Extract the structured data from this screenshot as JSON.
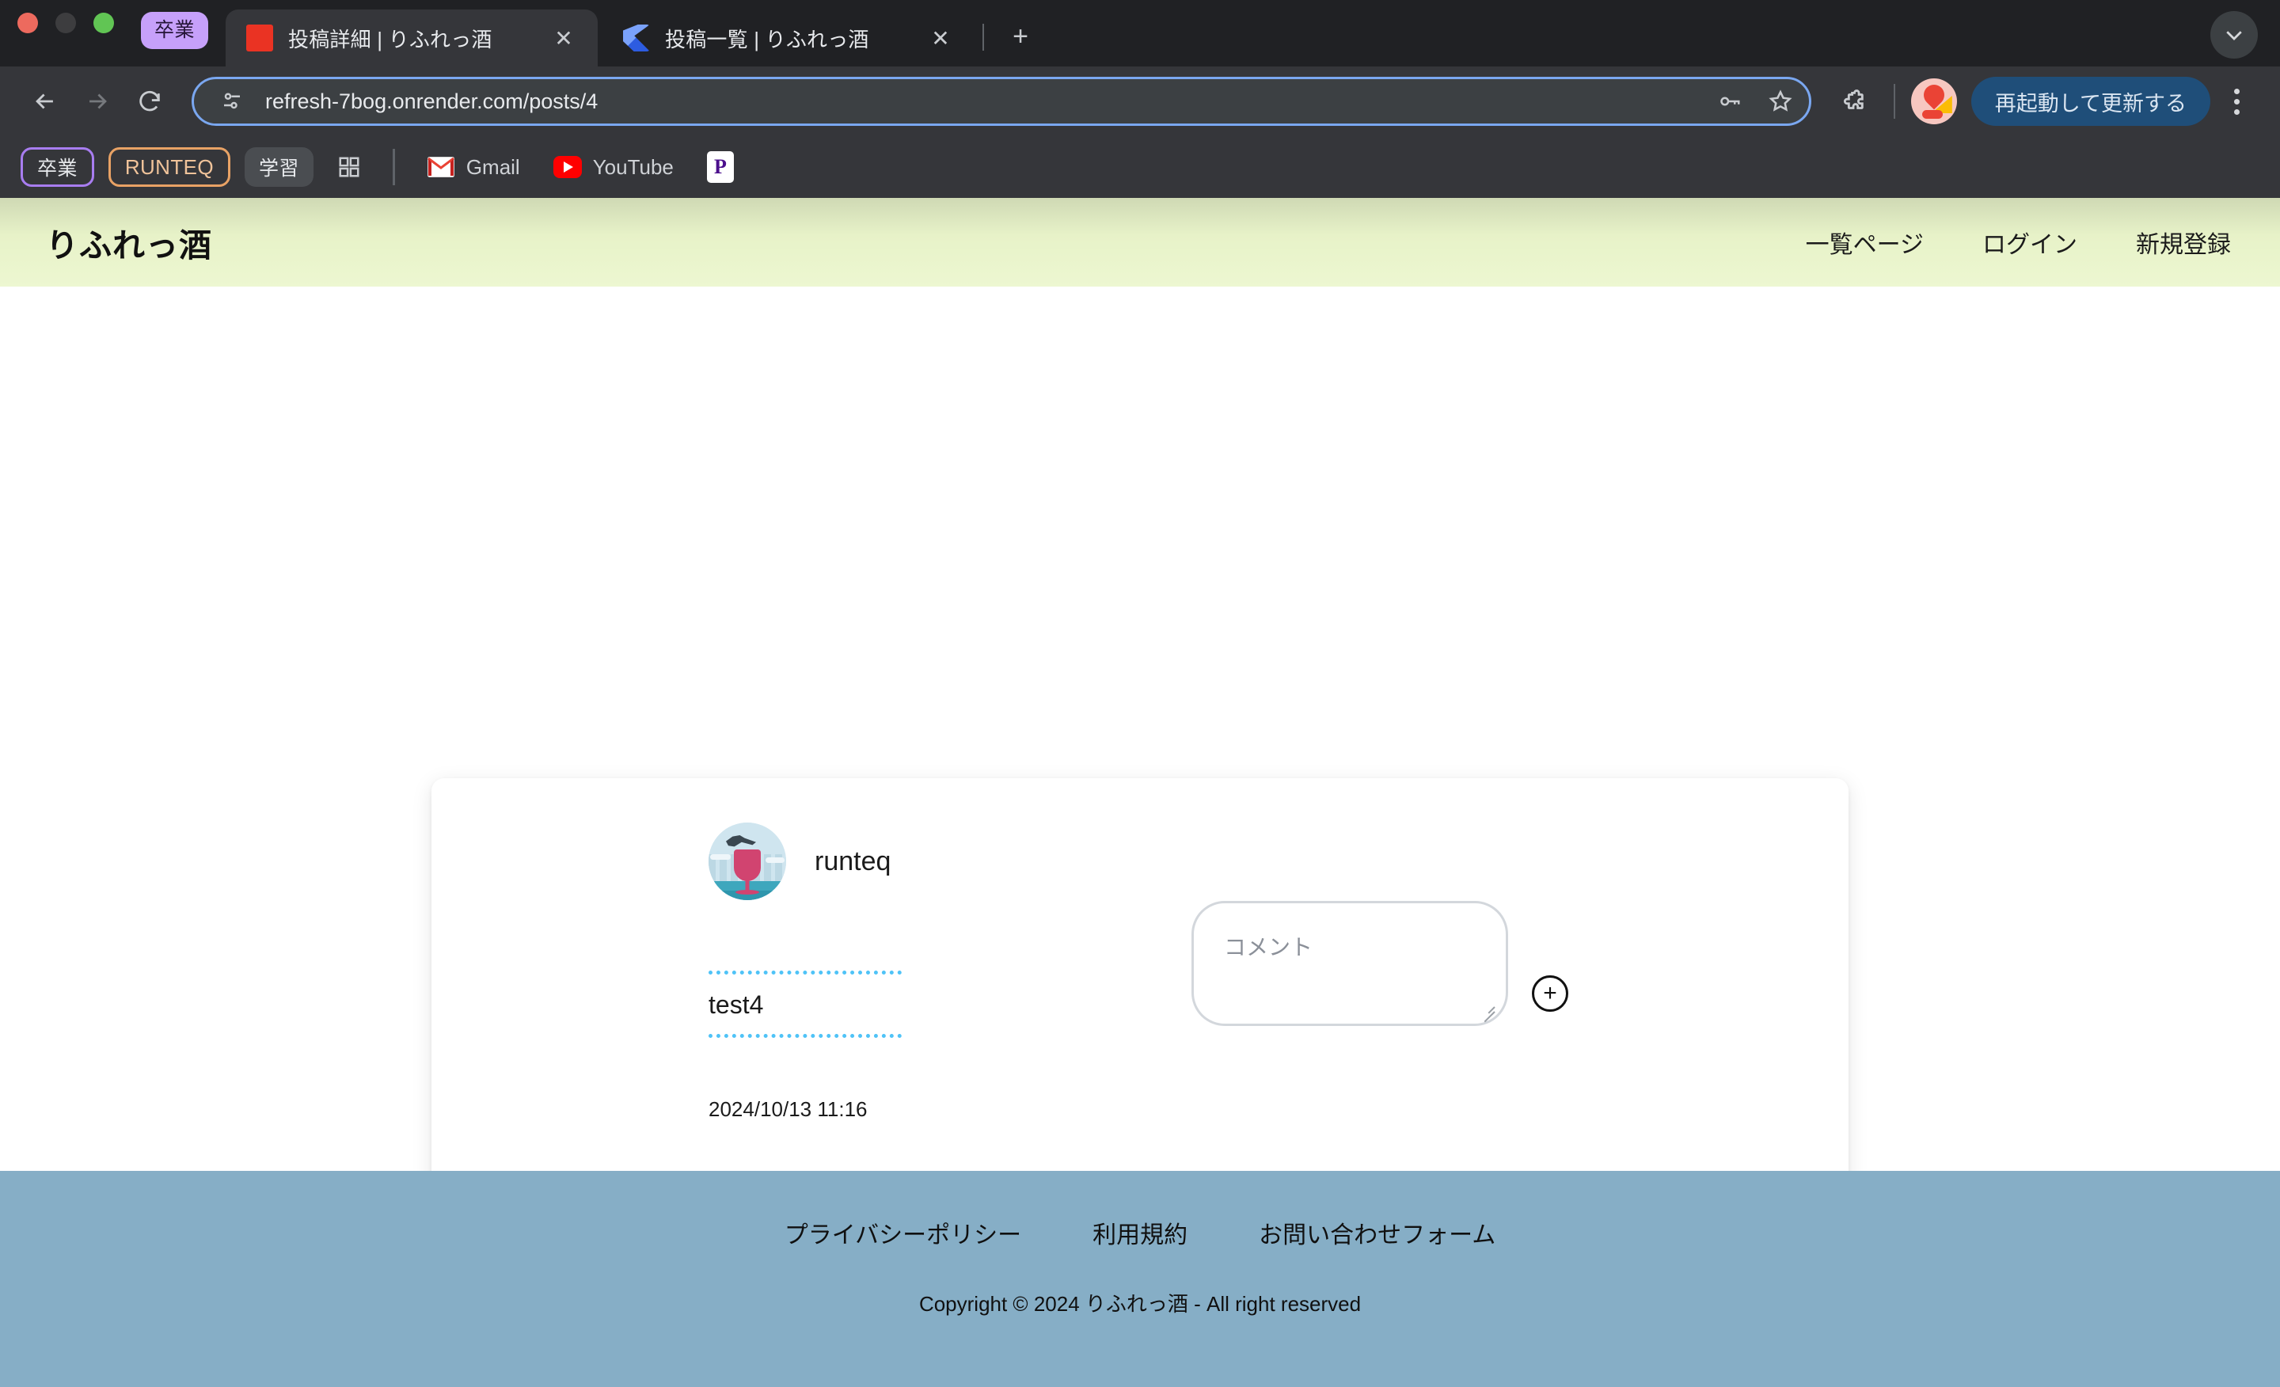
{
  "browser": {
    "tab_group_label": "卒業",
    "tabs": [
      {
        "title": "投稿詳細 | りふれっ酒",
        "favicon": "red-square-favicon",
        "active": true,
        "close_glyph": "✕"
      },
      {
        "title": "投稿一覧 | りふれっ酒",
        "favicon": "blue-flag-favicon",
        "active": false,
        "close_glyph": "✕"
      }
    ],
    "new_tab_glyph": "+",
    "tablist_chevron_glyph": "⌄",
    "nav": {
      "back_glyph": "←",
      "forward_glyph": "→",
      "reload_glyph": "⟳"
    },
    "omnibox": {
      "url": "refresh-7bog.onrender.com/posts/4",
      "site_info_icon": "tune-icon",
      "passkey_icon": "key-icon",
      "bookmark_icon": "star-icon"
    },
    "extensions_icon": "puzzle-icon",
    "profile_icon": "profile-avatar",
    "update_button_label": "再起動して更新する",
    "menu_icon": "kebab-menu-icon",
    "bookmarks": [
      {
        "label": "卒業",
        "style": "purple-outline"
      },
      {
        "label": "RUNTEQ",
        "style": "orange-outline"
      },
      {
        "label": "学習",
        "style": "gray-fill"
      },
      {
        "label": "",
        "style": "grid-icon"
      },
      {
        "label": "Gmail",
        "style": "gmail-icon"
      },
      {
        "label": "YouTube",
        "style": "youtube-icon"
      },
      {
        "label": "",
        "style": "p-icon"
      }
    ]
  },
  "site": {
    "brand": "りふれっ酒",
    "nav": [
      {
        "label": "一覧ページ"
      },
      {
        "label": "ログイン"
      },
      {
        "label": "新規登録"
      }
    ]
  },
  "post": {
    "username": "runteq",
    "avatar_icon": "wine-glass-avatar",
    "body": "test4",
    "timestamp": "2024/10/13 11:16"
  },
  "comment": {
    "placeholder": "コメント",
    "value": "",
    "submit_icon": "plus-circle-icon",
    "submit_glyph": "+"
  },
  "footer": {
    "links": [
      {
        "label": "プライバシーポリシー"
      },
      {
        "label": "利用規約"
      },
      {
        "label": "お問い合わせフォーム"
      }
    ],
    "copyright": "Copyright © 2024 りふれっ酒 - All right reserved"
  },
  "colors": {
    "header_gradient_top": "#cfd9b4",
    "header_gradient_bottom": "#edf7d1",
    "footer_bg": "#86aec6",
    "dotted_rule": "#4fc3f7",
    "update_button_bg": "#1f4e79"
  }
}
